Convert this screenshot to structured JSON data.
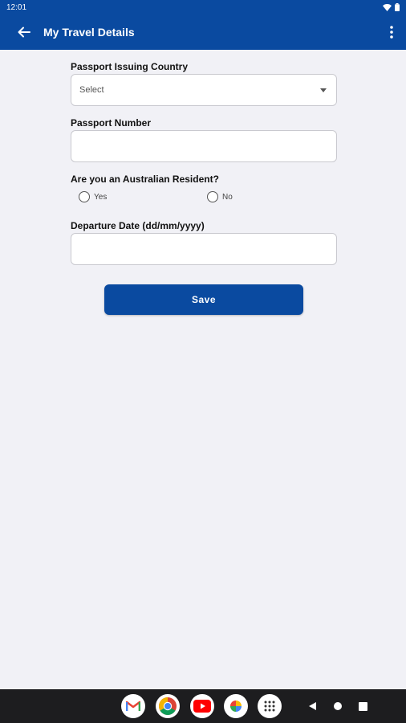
{
  "status_bar": {
    "time": "12:01"
  },
  "app_bar": {
    "title": "My Travel Details"
  },
  "form": {
    "passport_country": {
      "label": "Passport Issuing Country",
      "placeholder": "Select"
    },
    "passport_number": {
      "label": "Passport Number",
      "value": ""
    },
    "resident": {
      "label": "Are you an Australian Resident?",
      "options": [
        "Yes",
        "No"
      ]
    },
    "departure_date": {
      "label": "Departure Date (dd/mm/yyyy)",
      "value": ""
    },
    "save_label": "Save"
  },
  "nav": {
    "dock_apps": [
      "gmail-icon",
      "chrome-icon",
      "youtube-icon",
      "photos-icon",
      "app-drawer-icon"
    ],
    "buttons": [
      "back-icon",
      "home-icon",
      "recents-icon"
    ]
  },
  "colors": {
    "primary": "#0a4aa0",
    "background": "#f1f1f6"
  }
}
